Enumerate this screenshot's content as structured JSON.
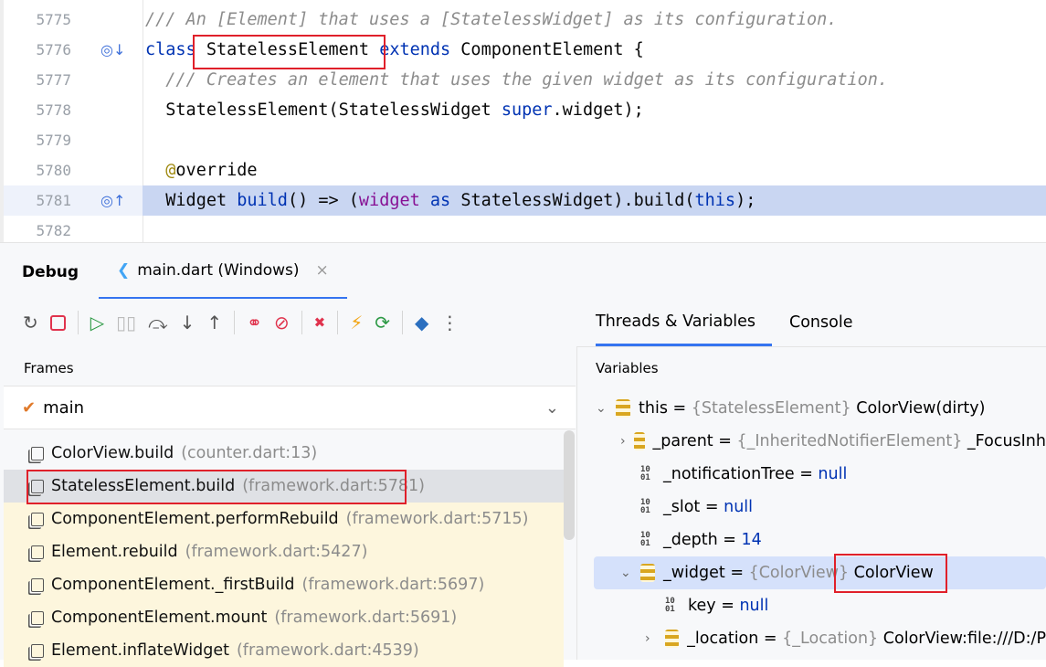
{
  "editor": {
    "lines": [
      {
        "num": "5775",
        "parts": [
          [
            "cm",
            "/// An [Element] that uses a [StatelessWidget] as its configuration."
          ]
        ]
      },
      {
        "num": "5776",
        "icon": "override-down-icon",
        "parts": [
          [
            "kw",
            "class "
          ],
          [
            "",
            "StatelessElement "
          ],
          [
            "kw",
            "extends "
          ],
          [
            "",
            "ComponentElement {"
          ]
        ]
      },
      {
        "num": "5777",
        "parts": [
          [
            "cm",
            "  /// Creates an element that uses the given widget as its configuration."
          ]
        ]
      },
      {
        "num": "5778",
        "parts": [
          [
            "",
            "  StatelessElement(StatelessWidget "
          ],
          [
            "kw",
            "super"
          ],
          [
            "",
            ".widget);"
          ]
        ]
      },
      {
        "num": "5779",
        "parts": []
      },
      {
        "num": "5780",
        "parts": [
          [
            "an",
            "  @"
          ],
          [
            "",
            "override"
          ]
        ]
      },
      {
        "num": "5781",
        "icon": "override-up-icon",
        "parts": [
          [
            "",
            "  Widget "
          ],
          [
            "kw",
            "build"
          ],
          [
            "",
            "() => ("
          ],
          [
            "fd",
            "widget"
          ],
          [
            "kw",
            " as "
          ],
          [
            "",
            "StatelessWidget).build("
          ],
          [
            "kw",
            "this"
          ],
          [
            "",
            ");"
          ]
        ]
      },
      {
        "num": "5782",
        "parts": []
      }
    ]
  },
  "debug": {
    "title": "Debug",
    "tab": "main.dart (Windows)"
  },
  "frames": {
    "header": "Frames",
    "thread": "main",
    "items": [
      {
        "name": "ColorView.build",
        "loc": "(counter.dart:13)"
      },
      {
        "name": "StatelessElement.build",
        "loc": "(framework.dart:5781)"
      },
      {
        "name": "ComponentElement.performRebuild",
        "loc": "(framework.dart:5715)"
      },
      {
        "name": "Element.rebuild",
        "loc": "(framework.dart:5427)"
      },
      {
        "name": "ComponentElement._firstBuild",
        "loc": "(framework.dart:5697)"
      },
      {
        "name": "ComponentElement.mount",
        "loc": "(framework.dart:5691)"
      },
      {
        "name": "Element.inflateWidget",
        "loc": "(framework.dart:4539)"
      }
    ]
  },
  "right": {
    "tabs": [
      "Threads & Variables",
      "Console"
    ],
    "header": "Variables",
    "vars": [
      {
        "arrow": "⌄",
        "indent": 0,
        "kind": "obj",
        "name": "this",
        "type": "{StatelessElement}",
        "value": "ColorView(dirty)"
      },
      {
        "arrow": "›",
        "indent": 1,
        "kind": "obj",
        "name": "_parent",
        "type": "{_InheritedNotifierElement}",
        "value": "_FocusInh"
      },
      {
        "arrow": "",
        "indent": 1,
        "kind": "prim",
        "name": "_notificationTree",
        "type": "",
        "value": "null"
      },
      {
        "arrow": "",
        "indent": 1,
        "kind": "prim",
        "name": "_slot",
        "type": "",
        "value": "null"
      },
      {
        "arrow": "",
        "indent": 1,
        "kind": "prim",
        "name": "_depth",
        "type": "",
        "value": "14"
      },
      {
        "arrow": "⌄",
        "indent": 1,
        "kind": "obj",
        "name": "_widget",
        "type": "{ColorView}",
        "value": "ColorView"
      },
      {
        "arrow": "",
        "indent": 2,
        "kind": "prim",
        "name": "key",
        "type": "",
        "value": "null"
      },
      {
        "arrow": "›",
        "indent": 2,
        "kind": "obj",
        "name": "_location",
        "type": "{_Location}",
        "value": "ColorView:file:///D:/P"
      }
    ]
  }
}
